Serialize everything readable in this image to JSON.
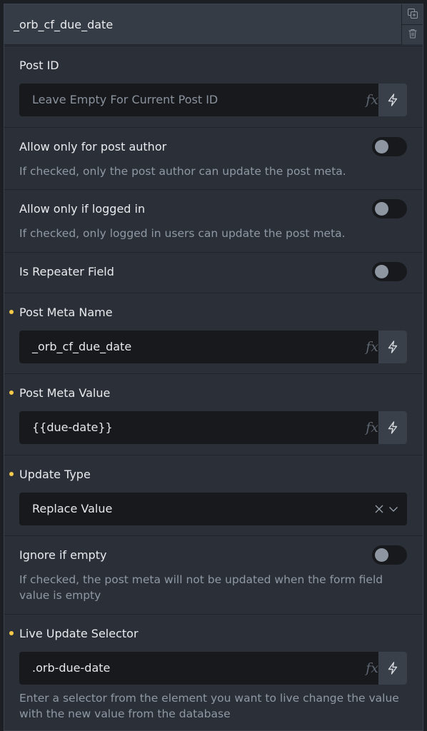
{
  "header": {
    "title": "_orb_cf_due_date"
  },
  "header_actions": {
    "duplicate_icon": "duplicate-icon",
    "delete_icon": "trash-icon"
  },
  "fields": {
    "post_id": {
      "label": "Post ID",
      "placeholder": "Leave Empty For Current Post ID",
      "value": ""
    },
    "allow_post_author": {
      "label": "Allow only for post author",
      "description": "If checked, only the post author can update the post meta.",
      "checked": false
    },
    "allow_logged_in": {
      "label": "Allow only if logged in",
      "description": "If checked, only logged in users can update the post meta.",
      "checked": false
    },
    "is_repeater": {
      "label": "Is Repeater Field",
      "checked": false
    },
    "post_meta_name": {
      "label": "Post Meta Name",
      "value": "_orb_cf_due_date",
      "required": true
    },
    "post_meta_value": {
      "label": "Post Meta Value",
      "value": "{{due-date}}",
      "required": true
    },
    "update_type": {
      "label": "Update Type",
      "value": "Replace Value",
      "required": true
    },
    "ignore_if_empty": {
      "label": "Ignore if empty",
      "description": "If checked, the post meta will not be updated when the form field value is empty",
      "checked": false
    },
    "live_update_selector": {
      "label": "Live Update Selector",
      "value": ".orb-due-date",
      "description": "Enter a selector from the element you want to live change the value with the new value from the database",
      "required": true
    }
  },
  "dynamic_data": {
    "fx_symbol": "fx",
    "fx_icon": "function-icon",
    "bolt_icon": "lightning-icon"
  },
  "colors": {
    "required_dot": "#f7c948",
    "panel_bg": "#2b3038",
    "input_bg": "#17191d"
  }
}
